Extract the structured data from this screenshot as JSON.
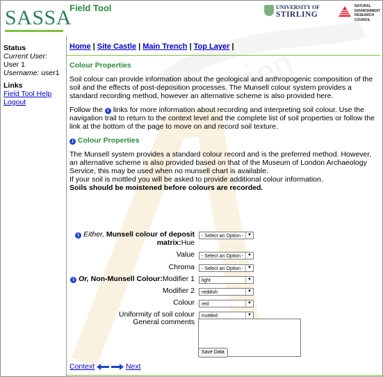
{
  "header": {
    "logo": "SASSA",
    "app_title": "Field Tool",
    "university_line1": "UNIVERSITY OF",
    "university_line2": "STIRLING",
    "nerc_line1": "NATURAL",
    "nerc_line2": "ENVIRONMENT",
    "nerc_line3": "RESEARCH COUNCIL"
  },
  "sidebar": {
    "status_heading": "Status",
    "current_user_label": "Current User:",
    "current_user_value": "User 1",
    "username_label": "Username:",
    "username_value": "user1",
    "links_heading": "Links",
    "links": [
      "Field Tool Help",
      "Logout"
    ]
  },
  "breadcrumb": {
    "items": [
      "Home",
      "Site Castle",
      "Main Trench",
      "Top Layer"
    ],
    "separator": "|"
  },
  "main": {
    "title": "Colour Properties",
    "para1": "Soil colour can provide information about the geological and anthropogenic composition of the soil and the effects of post-deposition processes. The Munsell colour system provides a standard recording method, however an alternative scheme is also provided here.",
    "para2_a": "Follow the",
    "para2_b": "links for more information about recording and interpreting soil colour. Use the navigation trail to return to the context level and the complete list of soil properties or follow the link at the bottom of the page to move on and record soil texture.",
    "section_title": "Colour Properties",
    "para3_l1": "The Munsell system provides a standard colour record and is the preferred method. However, an alternative scheme is also provided based on that of the Museum of London Archaeology Service, this may be used when no munsell chart is available.",
    "para3_l2": "If your soil is mottled you will be asked to provide additional colour information.",
    "para3_bold": "Soils should be moistened before colours are recorded."
  },
  "form": {
    "either_label": "Either,",
    "munsell_label_1": "Munsell colour of deposit",
    "munsell_label_2": "matrix:",
    "hue_label": "Hue",
    "value_label": "Value",
    "chroma_label": "Chroma",
    "or_label": "Or,",
    "non_munsell_label": "Non-Munsell Colour:",
    "modifier1_label": "Modifier 1",
    "modifier2_label": "Modifier 2",
    "colour_label": "Colour",
    "uniformity_label": "Uniformity of soil colour",
    "comments_label": "General comments",
    "hue_value": "- Select an Option -",
    "value_value": "- Select an Option -",
    "chroma_value": "- Select an Option -",
    "modifier1_value": "light",
    "modifier2_value": "reddish",
    "colour_value": "red",
    "uniformity_value": "mottled",
    "save_button": "Save Data"
  },
  "footer": {
    "context_link": "Context",
    "next_link": "Next"
  },
  "colors": {
    "brand_green": "#2d8a3a",
    "link_blue": "#0000cc",
    "accent_line": "#7fbf3f"
  }
}
